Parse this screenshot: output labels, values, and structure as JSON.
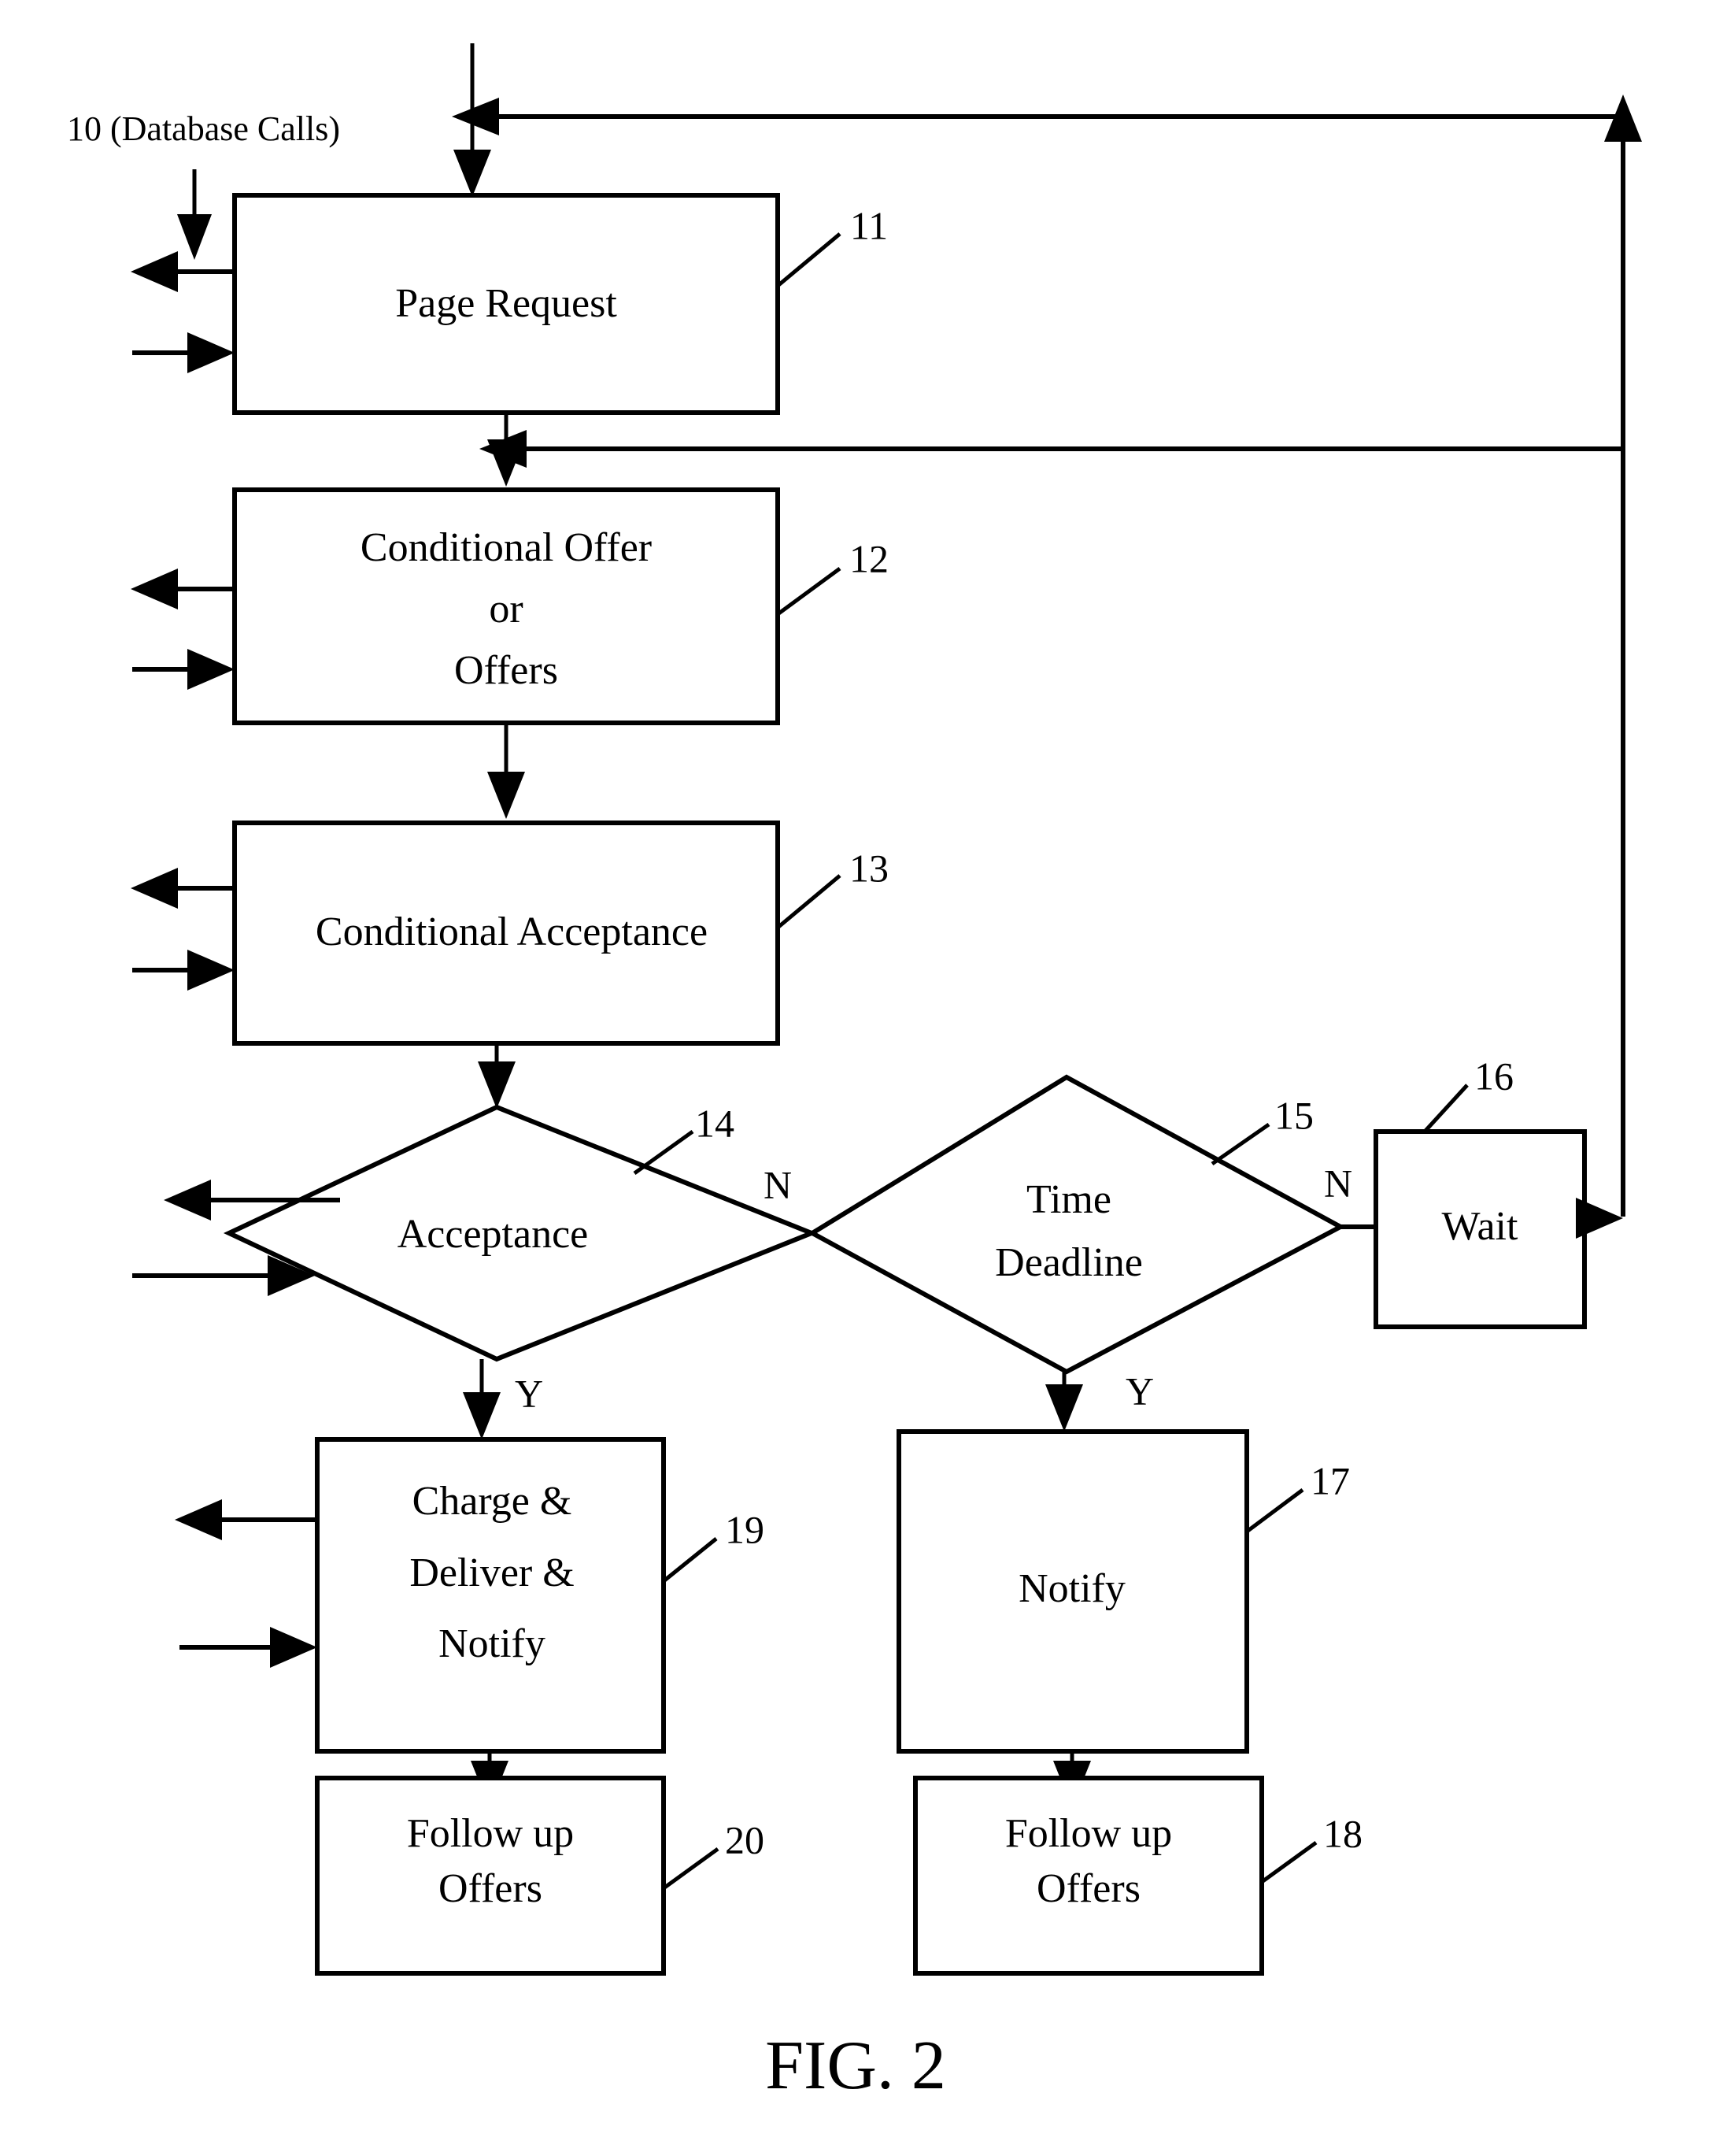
{
  "figure": {
    "caption": "FIG. 2",
    "annotation_label": "10 (Database Calls)"
  },
  "nodes": [
    {
      "id": "page-request",
      "ref": "11",
      "shape": "rect",
      "lines": [
        "Page Request"
      ]
    },
    {
      "id": "conditional-offer",
      "ref": "12",
      "shape": "rect",
      "lines": [
        "Conditional Offer",
        "or",
        "Offers"
      ]
    },
    {
      "id": "conditional-acceptance",
      "ref": "13",
      "shape": "rect",
      "lines": [
        "Conditional Acceptance"
      ]
    },
    {
      "id": "acceptance",
      "ref": "14",
      "shape": "diamond",
      "lines": [
        "Acceptance"
      ]
    },
    {
      "id": "time-deadline",
      "ref": "15",
      "shape": "diamond",
      "lines": [
        "Time",
        "Deadline"
      ]
    },
    {
      "id": "wait",
      "ref": "16",
      "shape": "rect",
      "lines": [
        "Wait"
      ]
    },
    {
      "id": "charge-deliver-notify",
      "ref": "19",
      "shape": "rect",
      "lines": [
        "Charge &",
        "Deliver &",
        "Notify"
      ]
    },
    {
      "id": "notify",
      "ref": "17",
      "shape": "rect",
      "lines": [
        "Notify"
      ]
    },
    {
      "id": "follow-up-offers-left",
      "ref": "20",
      "shape": "rect",
      "lines": [
        "Follow up",
        "Offers"
      ]
    },
    {
      "id": "follow-up-offers-right",
      "ref": "18",
      "shape": "rect",
      "lines": [
        "Follow up",
        "Offers"
      ]
    }
  ],
  "branch_labels": {
    "acceptance_no": "N",
    "acceptance_yes": "Y",
    "time_deadline_no": "N",
    "time_deadline_yes": "Y"
  },
  "colors": {
    "stroke": "#000000",
    "fill": "#ffffff",
    "background": "#ffffff"
  }
}
